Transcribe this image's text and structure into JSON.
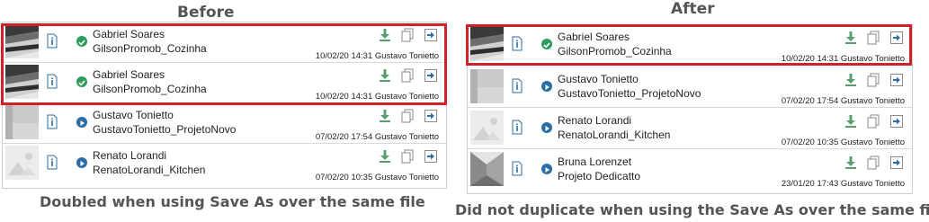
{
  "before": {
    "heading": "Before",
    "caption": "Doubled when using Save As over the same file",
    "rows": [
      {
        "name": "Gabriel Soares",
        "project": "GilsonPromob_Cozinha",
        "meta": "10/02/20 14:31 Gustavo Tonietto",
        "thumb": "kitchen-render",
        "status": "check-icon"
      },
      {
        "name": "Gabriel Soares",
        "project": "GilsonPromob_Cozinha",
        "meta": "10/02/20 14:31 Gustavo Tonietto",
        "thumb": "kitchen-render",
        "status": "check-icon"
      },
      {
        "name": "Gustavo Tonietto",
        "project": "GustavoTonietto_ProjetoNovo",
        "meta": "07/02/20 17:54 Gustavo Tonietto",
        "thumb": "gray-render",
        "status": "play-icon"
      },
      {
        "name": "Renato Lorandi",
        "project": "RenatoLorandi_Kitchen",
        "meta": "07/02/20 10:35 Gustavo Tonietto",
        "thumb": "placeholder-image",
        "status": "play-icon"
      }
    ]
  },
  "after": {
    "heading": "After",
    "caption": "Did not duplicate when using the Save As over the same file",
    "rows": [
      {
        "name": "Gabriel Soares",
        "project": "GilsonPromob_Cozinha",
        "meta": "10/02/20 14:31 Gustavo Tonietto",
        "thumb": "kitchen-render",
        "status": "check-icon"
      },
      {
        "name": "Gustavo Tonietto",
        "project": "GustavoTonietto_ProjetoNovo",
        "meta": "07/02/20 17:54 Gustavo Tonietto",
        "thumb": "gray-render",
        "status": "play-icon"
      },
      {
        "name": "Renato Lorandi",
        "project": "RenatoLorandi_Kitchen",
        "meta": "07/02/20 10:35 Gustavo Tonietto",
        "thumb": "placeholder-image",
        "status": "play-icon"
      },
      {
        "name": "Bruna Lorenzet",
        "project": "Projeto Dedicatto",
        "meta": "23/01/20 17:43 Gustavo Tonietto",
        "thumb": "room-render",
        "status": "play-icon"
      }
    ]
  },
  "colors": {
    "highlight": "#d21f2c",
    "success": "#2e9e5e",
    "primary": "#2b6ea7",
    "action_green": "#5a9e6f",
    "action_blue": "#2b6ea7"
  }
}
